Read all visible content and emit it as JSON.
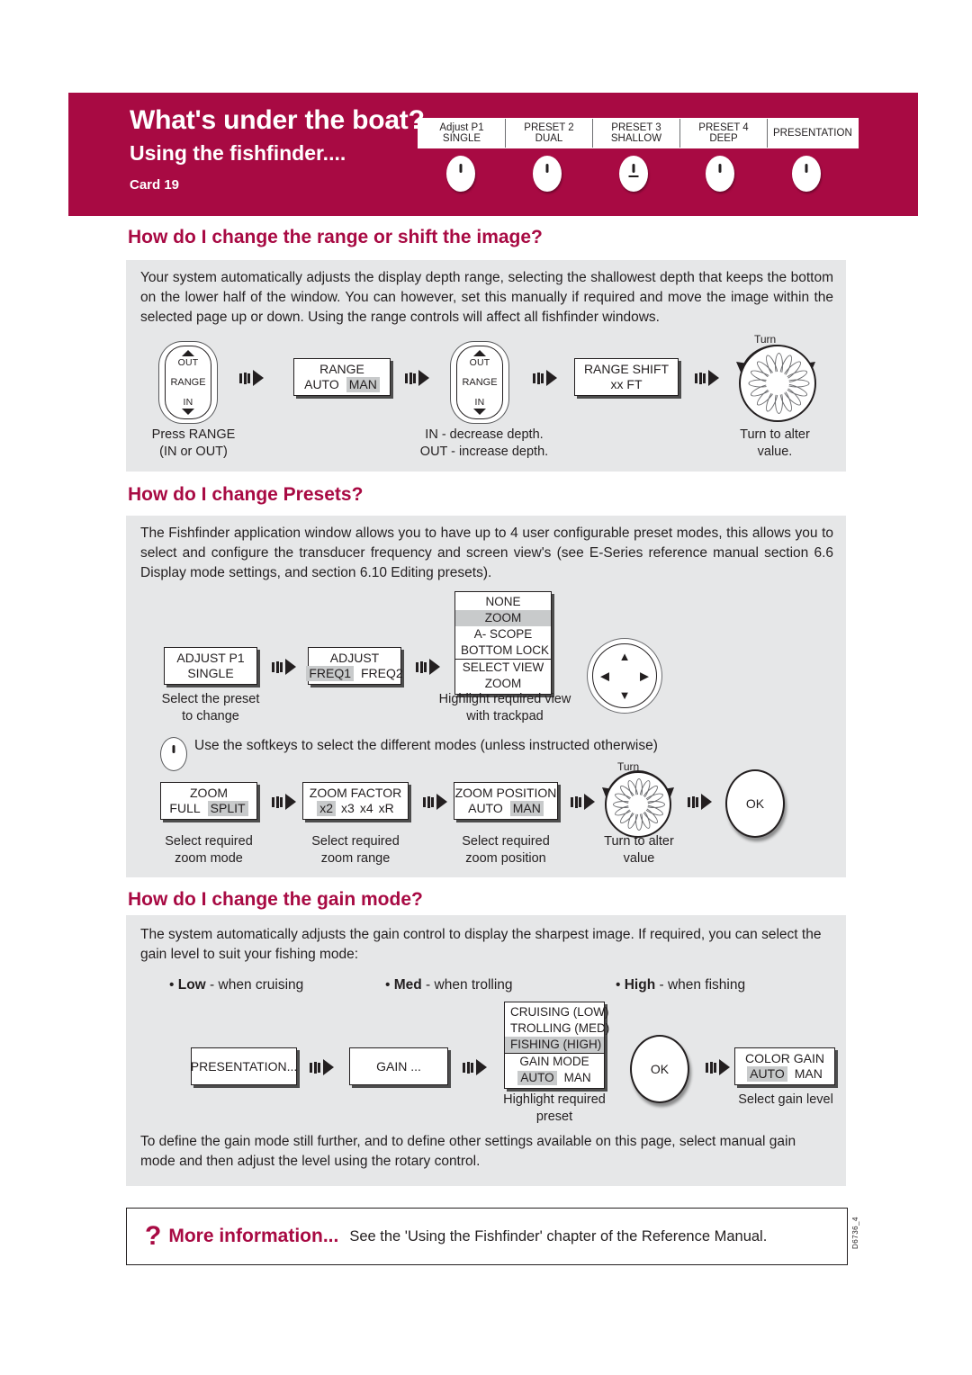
{
  "header": {
    "title": "What's under the boat?",
    "subtitle": "Using the fishfinder....",
    "card": "Card 19",
    "bg_color": "#A80A43",
    "softkeys": [
      {
        "line1": "Adjust P1",
        "line2": "SINGLE",
        "dot": "plain"
      },
      {
        "line1": "PRESET 2",
        "line2": "DUAL",
        "dot": "plain"
      },
      {
        "line1": "PRESET 3",
        "line2": "SHALLOW",
        "dot": "underlined"
      },
      {
        "line1": "PRESET 4",
        "line2": "DEEP",
        "dot": "plain"
      },
      {
        "line1": "PRESENTATION",
        "line2": "",
        "dot": "plain"
      }
    ]
  },
  "section_range": {
    "heading": "How do I change the range or shift the image?",
    "body": "Your system automatically adjusts the display depth range, selecting the shallowest depth that keeps the bottom on the lower half of the window. You can however, set this manually if required and move the image within the selected page up or down. Using the range controls will affect all fishfinder windows.",
    "rocker1": {
      "top": "OUT",
      "mid": "RANGE",
      "bottom": "IN"
    },
    "box_range": {
      "title": "RANGE",
      "options": [
        "AUTO",
        "MAN"
      ],
      "selected": "MAN"
    },
    "rocker2": {
      "top": "OUT",
      "mid": "RANGE",
      "bottom": "IN"
    },
    "box_shift": {
      "title": "RANGE SHIFT",
      "value": "xx FT"
    },
    "dial_label": "Turn",
    "captions": [
      "Press RANGE\n(IN or OUT)",
      "IN - decrease depth.\nOUT - increase depth.",
      "Turn to alter\nvalue."
    ],
    "caption1_l1": "Press RANGE",
    "caption1_l2": "(IN or OUT)",
    "caption2_l1": "IN - decrease depth.",
    "caption2_l2": "OUT - increase depth.",
    "caption3_l1": "Turn to alter",
    "caption3_l2": "value."
  },
  "section_presets": {
    "heading": "How do I change Presets?",
    "body": "The Fishfinder application window allows you to have up to 4 user configurable preset modes, this allows you to select and configure the transducer frequency and screen view's (see E-Series reference manual section 6.6 Display mode settings, and section 6.10 Editing presets).",
    "box_adjust_p1": {
      "line1": "ADJUST P1",
      "line2": "SINGLE"
    },
    "box_adjust_freq": {
      "title": "ADJUST",
      "options": [
        "FREQ1",
        "FREQ2"
      ],
      "selected": "FREQ1"
    },
    "view_menu": {
      "items": [
        "NONE",
        "ZOOM",
        "A- SCOPE",
        "BOTTOM LOCK"
      ],
      "selected": "ZOOM",
      "footer_line1": "SELECT VIEW",
      "footer_line2": "ZOOM"
    },
    "caption_preset_l1": "Select the preset",
    "caption_preset_l2": "to change",
    "caption_view_l1": "Highlight required view",
    "caption_view_l2": "with trackpad",
    "softkey_note": "Use the softkeys to select the different modes (unless instructed otherwise)",
    "box_zoom": {
      "title": "ZOOM",
      "options": [
        "FULL",
        "SPLIT"
      ],
      "selected": "SPLIT"
    },
    "box_zoom_factor": {
      "title": "ZOOM FACTOR",
      "options": [
        "x2",
        "x3",
        "x4",
        "xR"
      ],
      "selected": "x2"
    },
    "box_zoom_position": {
      "title": "ZOOM POSITION",
      "options": [
        "AUTO",
        "MAN"
      ],
      "selected": "MAN"
    },
    "dial_label": "Turn",
    "ok_label": "OK",
    "caption_zoom_mode_l1": "Select required",
    "caption_zoom_mode_l2": "zoom mode",
    "caption_zoom_range_l1": "Select required",
    "caption_zoom_range_l2": "zoom range",
    "caption_zoom_pos_l1": "Select required",
    "caption_zoom_pos_l2": "zoom position",
    "caption_turn_l1": "Turn to alter",
    "caption_turn_l2": "value"
  },
  "section_gain": {
    "heading": "How do I change the gain mode?",
    "body": "The system automatically adjusts the gain control to display the sharpest image.  If required, you can select the gain level to suit your fishing mode:",
    "bullets": [
      {
        "bold": "Low",
        "rest": " - when cruising"
      },
      {
        "bold": "Med",
        "rest": " - when trolling"
      },
      {
        "bold": "High",
        "rest": " - when fishing"
      }
    ],
    "box_presentation": "PRESENTATION...",
    "box_gain": "GAIN ...",
    "gain_menu": {
      "items": [
        "CRUISING (LOW)",
        "TROLLING (MED)",
        "FISHING (HIGH)"
      ],
      "selected": "FISHING (HIGH)",
      "footer_title": "GAIN MODE",
      "footer_options": [
        "AUTO",
        "MAN"
      ],
      "footer_selected": "AUTO"
    },
    "ok_label": "OK",
    "box_color_gain": {
      "title": "COLOR GAIN",
      "options": [
        "AUTO",
        "MAN"
      ],
      "selected": "AUTO"
    },
    "caption_highlight_l1": "Highlight required",
    "caption_highlight_l2": "preset",
    "caption_gain_level": "Select gain level",
    "body2": "To define the gain mode still further, and to define other settings available on this page, select manual gain mode and then adjust the level using the rotary control."
  },
  "footer": {
    "question_mark": "?",
    "more_info": "More information...",
    "see_text": "See the 'Using the Fishfinder' chapter of the Reference Manual.",
    "doc_code": "D6736_4"
  }
}
